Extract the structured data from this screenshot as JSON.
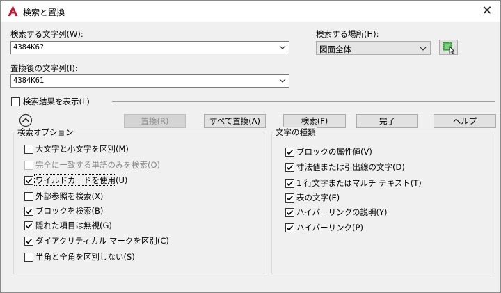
{
  "window": {
    "title": "検索と置換",
    "close": "✕"
  },
  "find": {
    "label": "検索する文字列(W):",
    "value": "4384K6?"
  },
  "replace": {
    "label": "置換後の文字列(I):",
    "value": "4384K61"
  },
  "where": {
    "label": "検索する場所(H):",
    "value": "図面全体"
  },
  "list_results": {
    "label": "検索結果を表示(L)",
    "checked": false
  },
  "buttons": {
    "replace": "置換(R)",
    "replace_all": "すべて置換(A)",
    "find": "検索(F)",
    "done": "完了",
    "help": "ヘルプ"
  },
  "search_options": {
    "title": "検索オプション",
    "items": [
      {
        "label": "大文字と小文字を区別(M)",
        "checked": false,
        "disabled": false
      },
      {
        "label": "完全に一致する単語のみを検索(O)",
        "checked": false,
        "disabled": true
      },
      {
        "label": "ワイルドカードを使用(U)",
        "checked": true,
        "disabled": false
      },
      {
        "label": "外部参照を検索(X)",
        "checked": false,
        "disabled": false
      },
      {
        "label": "ブロックを検索(B)",
        "checked": true,
        "disabled": false
      },
      {
        "label": "隠れた項目は無視(G)",
        "checked": true,
        "disabled": false
      },
      {
        "label": "ダイアクリティカル マークを区別(C)",
        "checked": true,
        "disabled": false
      },
      {
        "label": "半角と全角を区別しない(S)",
        "checked": false,
        "disabled": false
      }
    ]
  },
  "text_types": {
    "title": "文字の種類",
    "items": [
      {
        "label": "ブロックの属性値(V)",
        "checked": true
      },
      {
        "label": "寸法値または引出線の文字(D)",
        "checked": true
      },
      {
        "label": "1 行文字またはマルチ テキスト(T)",
        "checked": true
      },
      {
        "label": "表の文字(E)",
        "checked": true
      },
      {
        "label": "ハイパーリンクの説明(Y)",
        "checked": true
      },
      {
        "label": "ハイパーリンク(P)",
        "checked": true
      }
    ]
  },
  "colors": {
    "accent": "#c8102e",
    "pick_green": "#1a8a2e"
  }
}
